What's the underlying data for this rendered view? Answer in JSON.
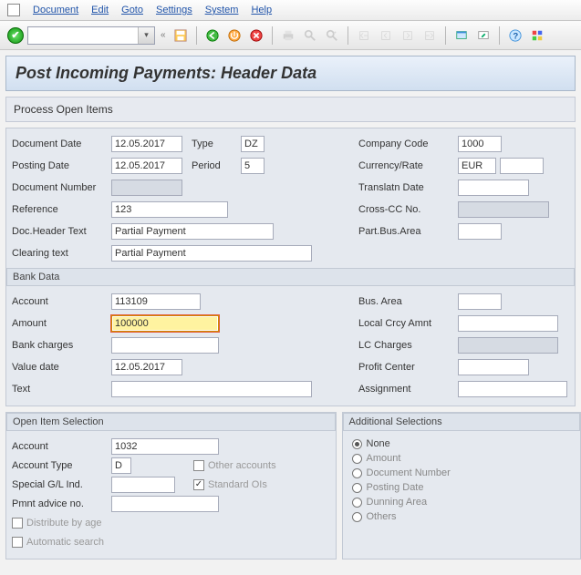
{
  "menu": {
    "document": "Document",
    "edit": "Edit",
    "goto": "Goto",
    "settings": "Settings",
    "system": "System",
    "help": "Help"
  },
  "title": "Post Incoming Payments: Header Data",
  "subheader": "Process Open Items",
  "hdr": {
    "doc_date_label": "Document Date",
    "doc_date": "12.05.2017",
    "type_label": "Type",
    "type": "DZ",
    "company_label": "Company Code",
    "company": "1000",
    "post_date_label": "Posting Date",
    "post_date": "12.05.2017",
    "period_label": "Period",
    "period": "5",
    "currency_label": "Currency/Rate",
    "currency": "EUR",
    "rate": "",
    "docnum_label": "Document Number",
    "docnum": "",
    "trans_date_label": "Translatn Date",
    "trans_date": "",
    "reference_label": "Reference",
    "reference": "123",
    "crosscc_label": "Cross-CC No.",
    "crosscc": "",
    "dochead_label": "Doc.Header Text",
    "dochead": "Partial Payment",
    "partbus_label": "Part.Bus.Area",
    "partbus": "",
    "clearing_label": "Clearing text",
    "clearing": "Partial Payment"
  },
  "bank": {
    "title": "Bank Data",
    "account_label": "Account",
    "account": "113109",
    "busarea_label": "Bus. Area",
    "busarea": "",
    "amount_label": "Amount",
    "amount": "100000",
    "lcamount_label": "Local Crcy Amnt",
    "lcamount": "",
    "charges_label": "Bank charges",
    "charges": "",
    "lccharges_label": "LC Charges",
    "lccharges": "",
    "valdate_label": "Value date",
    "valdate": "12.05.2017",
    "profit_label": "Profit Center",
    "profit": "",
    "text_label": "Text",
    "text": "",
    "assignment_label": "Assignment",
    "assignment": ""
  },
  "open": {
    "title": "Open Item Selection",
    "account_label": "Account",
    "account": "1032",
    "type_label": "Account Type",
    "type": "D",
    "other_label": "Other accounts",
    "sgl_label": "Special G/L Ind.",
    "sgl": "",
    "std_label": "Standard OIs",
    "std_checked": true,
    "advice_label": "Pmnt advice no.",
    "advice": "",
    "dist_label": "Distribute by age",
    "auto_label": "Automatic search"
  },
  "addsel": {
    "title": "Additional Selections",
    "none": "None",
    "amount": "Amount",
    "docnum": "Document Number",
    "postdate": "Posting Date",
    "dunning": "Dunning Area",
    "others": "Others",
    "selected": "none"
  }
}
